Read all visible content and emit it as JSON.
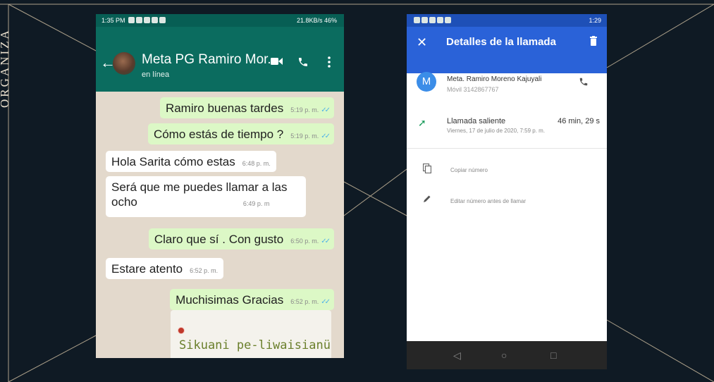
{
  "slide": {
    "side_text": "ORGANIZA",
    "colors": {
      "background": "#0f1a24",
      "line": "#c8b89c",
      "side_text": "#e9dfcd"
    }
  },
  "whatsapp": {
    "status_bar": {
      "time": "1:35 PM",
      "right": "21.8KB/s  46%"
    },
    "header": {
      "contact_name": "Meta PG Ramiro Mor...",
      "status": "en línea",
      "icons": [
        "back-arrow-icon",
        "avatar",
        "video-call-icon",
        "phone-icon",
        "more-vert-icon"
      ]
    },
    "messages": [
      {
        "direction": "out",
        "text": "Ramiro buenas tardes",
        "time": "5:19 p. m."
      },
      {
        "direction": "out",
        "text": "Cómo estás de tiempo ?",
        "time": "5:19 p. m."
      },
      {
        "direction": "in",
        "text": "Hola Sarita cómo estas",
        "time": "6:48 p. m."
      },
      {
        "direction": "in",
        "line1": "Será que me puedes llamar a las",
        "line2": "ocho",
        "time": "6:49 p. m"
      },
      {
        "direction": "out",
        "text": "Claro que sí . Con gusto",
        "time": "6:50 p. m."
      },
      {
        "direction": "in",
        "text": "Estare atento",
        "time": "6:52 p. m."
      },
      {
        "direction": "out",
        "text": "Muchisimas Gracias",
        "time": "6:52 p. m."
      }
    ],
    "image_card": {
      "text": "Sikuani pe-liwaisianü"
    },
    "colors": {
      "header": "#0b6c5f",
      "status_bar": "#075e54",
      "bubble_out": "#dcf8c6",
      "bubble_in": "#ffffff",
      "chat_bg": "#e3d9cc",
      "ticks": "#4fb3e8"
    }
  },
  "call_details": {
    "status_bar": {
      "time": "1:29"
    },
    "app_bar": {
      "title": "Detalles de la llamada"
    },
    "contact": {
      "initial": "M",
      "name": "Meta. Ramiro Moreno Kajuyali",
      "number": "Móvil 3142867767"
    },
    "call": {
      "type": "Llamada saliente",
      "duration": "46 min, 29 s",
      "date": "Viernes, 17 de julio de 2020, 7:59 p. m."
    },
    "actions": [
      {
        "icon": "copy-icon",
        "label": "Copiar número"
      },
      {
        "icon": "edit-pencil-icon",
        "label": "Editar número antes de llamar"
      }
    ],
    "nav": [
      "back-triangle-icon",
      "home-circle-icon",
      "recents-square-icon"
    ],
    "colors": {
      "app_bar": "#2a62d8",
      "status_bar": "#1e50b7",
      "outgoing_arrow": "#1a9b5b",
      "avatar": "#3b8de8"
    }
  }
}
